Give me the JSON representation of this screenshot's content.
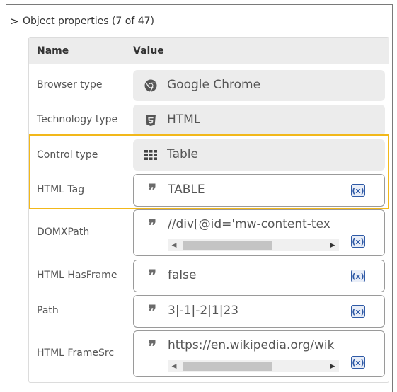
{
  "section": {
    "title": "Object properties (7 of 47)"
  },
  "table": {
    "col_name": "Name",
    "col_value": "Value"
  },
  "rows": [
    {
      "label": "Browser type",
      "value": "Google Chrome",
      "icon": "chrome-icon"
    },
    {
      "label": "Technology type",
      "value": "HTML",
      "icon": "html5-icon"
    },
    {
      "label": "Control type",
      "value": "Table",
      "icon": "table-grid-icon"
    },
    {
      "label": "HTML Tag",
      "value": "TABLE",
      "icon": "quote-icon",
      "var_button": "(x)"
    },
    {
      "label": "DOMXPath",
      "value": "//div[@id='mw-content-tex",
      "icon": "quote-icon",
      "var_button": "(x)"
    },
    {
      "label": "HTML HasFrame",
      "value": "false",
      "icon": "quote-icon",
      "var_button": "(x)"
    },
    {
      "label": "Path",
      "value": "3|-1|-2|1|23",
      "icon": "quote-icon",
      "var_button": "(x)"
    },
    {
      "label": "HTML FrameSrc",
      "value": "https://en.wikipedia.org/wik",
      "icon": "quote-icon",
      "var_button": "(x)"
    }
  ],
  "colors": {
    "highlight": "#f2b81a",
    "var_button": "#2f5aa6"
  }
}
